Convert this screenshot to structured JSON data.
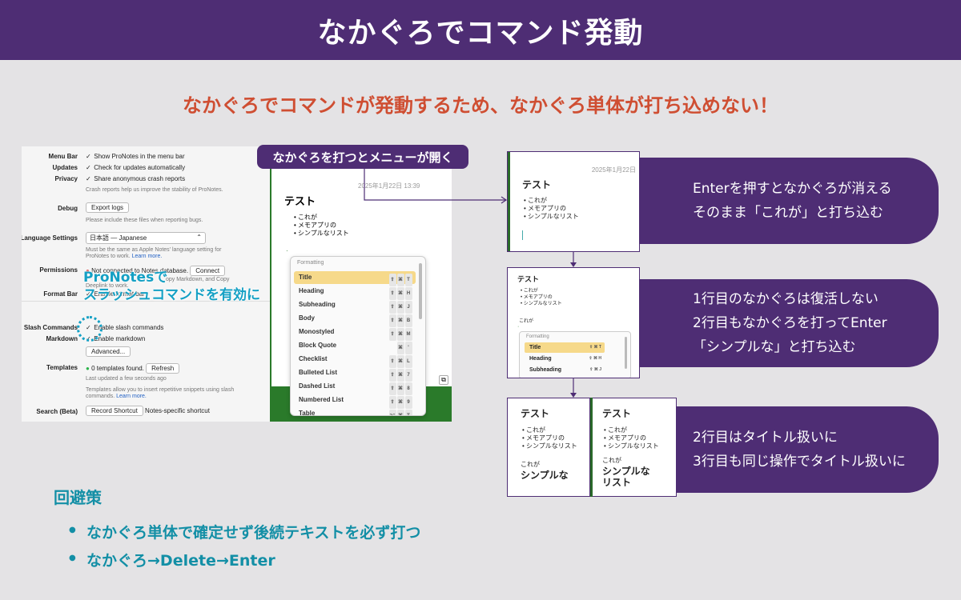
{
  "header": {
    "title": "なかぐろでコマンド発動"
  },
  "subtitle": "なかぐろでコマンドが発動するため、なかぐろ単体が打ち込めない！",
  "settings": {
    "rows": [
      {
        "label": "Menu Bar",
        "value": "Show ProNotes in the menu bar"
      },
      {
        "label": "Updates",
        "value": "Check for updates automatically"
      },
      {
        "label": "Privacy",
        "value": "Share anonymous crash reports"
      },
      {
        "label": "",
        "value": "Crash reports help us improve the stability of ProNotes."
      },
      {
        "label": "Debug",
        "value": "Export logs"
      },
      {
        "label": "",
        "value": "Please include these files when reporting bugs."
      },
      {
        "label": "Language Settings",
        "value": "日本語 — Japanese"
      },
      {
        "label": "",
        "value": "Must be the same as Apple Notes' language setting for"
      },
      {
        "label": "",
        "value": "ProNotes to work.",
        "link": "Learn more."
      },
      {
        "label": "Permissions",
        "value": "Not connected to Notes database.",
        "button": "Connect"
      },
      {
        "label": "",
        "value": "opy Markdown, and Copy"
      },
      {
        "label": "",
        "value": "Deeplink to work."
      },
      {
        "label": "Format Bar",
        "value": "Enable format bar"
      },
      {
        "label": "Slash Commands",
        "value": "Enable slash commands"
      },
      {
        "label": "Markdown",
        "value": "Enable markdown"
      },
      {
        "label": "",
        "value": "Advanced..."
      },
      {
        "label": "Templates",
        "value": "0 templates found.",
        "button": "Refresh"
      },
      {
        "label": "",
        "value": "Last updated a few seconds ago"
      },
      {
        "label": "",
        "value": "Templates allow you to insert repetitive snippets using slash"
      },
      {
        "label": "",
        "value": "commands.",
        "link": "Learn more."
      },
      {
        "label": "Search (Beta)",
        "value": "Record Shortcut",
        "extra": "Notes-specific shortcut"
      }
    ],
    "callout_line1": "ProNotesで",
    "callout_line2": "スラッシュコマンドを有効に"
  },
  "editor": {
    "pill_label": "なかぐろを打つとメニューが開く",
    "date": "2025年1月22日 13:39",
    "note_title": "テスト",
    "bullets": [
      "これが",
      "メモアプリの",
      "シンプルなリスト"
    ],
    "menu_header": "Formatting",
    "menu_items": [
      {
        "label": "Title",
        "keys": [
          "⇧",
          "⌘",
          "T"
        ]
      },
      {
        "label": "Heading",
        "keys": [
          "⇧",
          "⌘",
          "H"
        ]
      },
      {
        "label": "Subheading",
        "keys": [
          "⇧",
          "⌘",
          "J"
        ]
      },
      {
        "label": "Body",
        "keys": [
          "⇧",
          "⌘",
          "B"
        ]
      },
      {
        "label": "Monostyled",
        "keys": [
          "⇧",
          "⌘",
          "M"
        ]
      },
      {
        "label": "Block Quote",
        "keys": [
          "⌘",
          "'"
        ]
      },
      {
        "label": "Checklist",
        "keys": [
          "⇧",
          "⌘",
          "L"
        ]
      },
      {
        "label": "Bulleted List",
        "keys": [
          "⇧",
          "⌘",
          "7"
        ]
      },
      {
        "label": "Dashed List",
        "keys": [
          "⇧",
          "⌘",
          "8"
        ]
      },
      {
        "label": "Numbered List",
        "keys": [
          "⇧",
          "⌘",
          "9"
        ]
      },
      {
        "label": "Table",
        "keys": [
          "⌥",
          "⌘",
          "T"
        ]
      }
    ]
  },
  "steps": [
    {
      "line1": "Enterを押すとなかぐろが消える",
      "line2": "そのまま「これが」と打ち込む"
    },
    {
      "line1": "1行目のなかぐろは復活しない",
      "line2": "2行目もなかぐろを打ってEnter",
      "line3": "「シンプルな」と打ち込む"
    },
    {
      "line1": "2行目はタイトル扱いに",
      "line2": "3行目も同じ操作でタイトル扱いに"
    }
  ],
  "shot1": {
    "date": "2025年1月22日",
    "title": "テスト",
    "bullets": [
      "これが",
      "メモアプリの",
      "シンプルなリスト"
    ]
  },
  "shot2": {
    "title": "テスト",
    "bullets": [
      "これが",
      "メモアプリの",
      "シンプルなリスト"
    ],
    "line": "これが",
    "menu_header": "Formatting",
    "items": [
      {
        "label": "Title",
        "keys": "⇧ ⌘ T"
      },
      {
        "label": "Heading",
        "keys": "⇧ ⌘ H"
      },
      {
        "label": "Subheading",
        "keys": "⇧ ⌘ J"
      }
    ]
  },
  "shot3a": {
    "title": "テスト",
    "bullets": [
      "これが",
      "メモアプリの",
      "シンプルなリスト"
    ],
    "small": "これが",
    "big": "シンプルな"
  },
  "shot3b": {
    "title": "テスト",
    "bullets": [
      "これが",
      "メモアプリの",
      "シンプルなリスト"
    ],
    "small": "これが",
    "big1": "シンプルな",
    "big2": "リスト"
  },
  "tips": {
    "heading": "回避策",
    "items": [
      "なかぐろ単体で確定せず後続テキストを必ず打つ",
      "なかぐろ→Delete→Enter"
    ]
  }
}
